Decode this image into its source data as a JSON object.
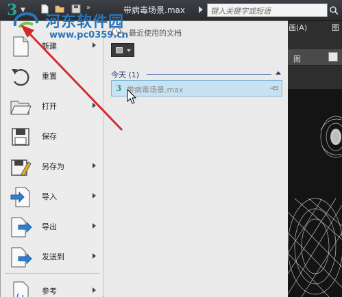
{
  "titlebar": {
    "file_title": "带病毒场景.max",
    "search_placeholder": "键入关键字或短语",
    "app_icon": "3ds-max-logo-icon",
    "quick_access": [
      "new-file-icon",
      "open-folder-icon",
      "save-icon"
    ]
  },
  "background": {
    "menu_fragment": "画(A)",
    "menu_fragment2": "图",
    "viewport_label": "图"
  },
  "commands": [
    {
      "label": "新建",
      "icon": "new-file-icon",
      "has_submenu": true
    },
    {
      "label": "重置",
      "icon": "reset-icon",
      "has_submenu": false
    },
    {
      "label": "打开",
      "icon": "open-folder-icon",
      "has_submenu": true
    },
    {
      "label": "保存",
      "icon": "save-icon",
      "has_submenu": false
    },
    {
      "label": "另存为",
      "icon": "save-as-icon",
      "has_submenu": true
    },
    {
      "label": "导入",
      "icon": "import-icon",
      "has_submenu": true
    },
    {
      "label": "导出",
      "icon": "export-icon",
      "has_submenu": true
    },
    {
      "label": "发送到",
      "icon": "send-to-icon",
      "has_submenu": true
    },
    {
      "label": "参考",
      "icon": "reference-icon",
      "has_submenu": true
    }
  ],
  "recent": {
    "header": "最近使用的文档",
    "group_label": "今天 (1)",
    "items": [
      {
        "number": "3",
        "name": "带病毒场景.max"
      }
    ]
  },
  "watermark": {
    "title": "河东软件园",
    "url": "www.pc0359.cn"
  },
  "colors": {
    "annotation_arrow": "#d42a2a",
    "selected_item": "#c7e3f3",
    "accent": "#1e9a8f"
  }
}
